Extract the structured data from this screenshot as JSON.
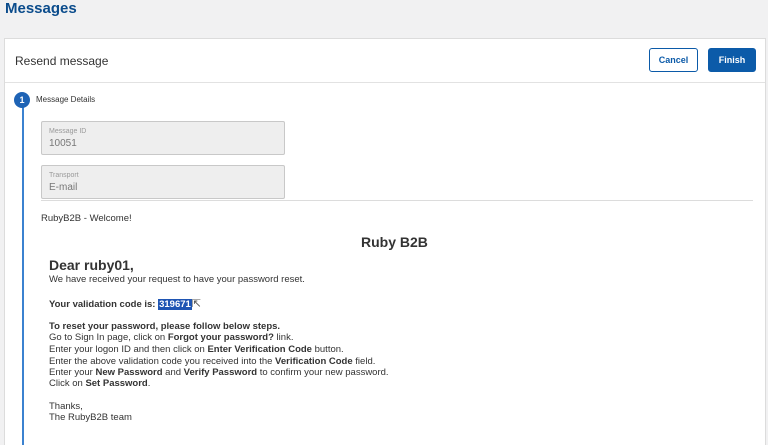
{
  "page": {
    "title": "Messages"
  },
  "card": {
    "title": "Resend message",
    "cancel_label": "Cancel",
    "finish_label": "Finish"
  },
  "step": {
    "number": "1",
    "label": "Message Details"
  },
  "fields": {
    "message_id": {
      "label": "Message ID",
      "value": "10051"
    },
    "transport": {
      "label": "Transport",
      "value": "E-mail"
    }
  },
  "email": {
    "subject": "RubyB2B - Welcome!",
    "brand": "Ruby B2B",
    "greeting": "Dear ruby01,",
    "intro": "We have received your request to have your password reset.",
    "code_label": "Your validation code is:",
    "code": "319671",
    "steps_heading": "To reset your password, please follow below steps.",
    "s1_a": "Go to Sign In page, click on ",
    "s1_b": "Forgot your password?",
    "s1_c": " link.",
    "s2_a": "Enter your logon ID and then click on ",
    "s2_b": "Enter Verification Code",
    "s2_c": " button.",
    "s3_a": "Enter the above validation code you received into the ",
    "s3_b": "Verification Code",
    "s3_c": " field.",
    "s4_a": "Enter your ",
    "s4_b": "New Password",
    "s4_c": " and ",
    "s4_d": "Verify Password",
    "s4_e": " to confirm your new password.",
    "s5_a": "Click on ",
    "s5_b": "Set Password",
    "s5_c": ".",
    "thanks": "Thanks,",
    "signature": "The RubyB2B team"
  }
}
